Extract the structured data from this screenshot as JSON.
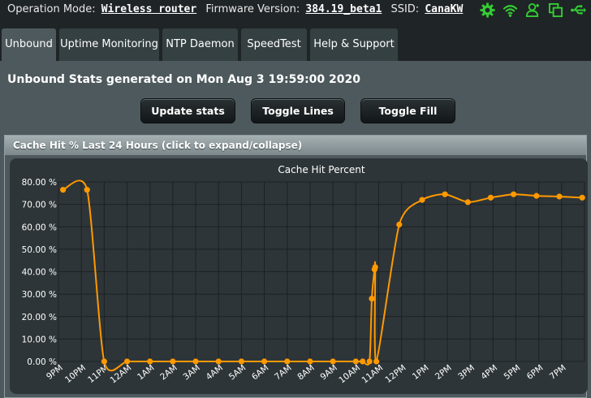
{
  "topbar": {
    "op_mode_label": "Operation Mode:",
    "op_mode_value": "Wireless router",
    "firmware_label": "Firmware Version:",
    "firmware_value": "384.19_beta1",
    "ssid_label": "SSID:",
    "ssid_value": "CanaKW"
  },
  "colors": {
    "icon_green": "#33cc33",
    "line_orange": "#ff9900",
    "chart_bg": "#2e3538",
    "page_bg": "#4d595d"
  },
  "tabs": [
    {
      "label": "Unbound",
      "active": true
    },
    {
      "label": "Uptime Monitoring",
      "active": false
    },
    {
      "label": "NTP Daemon",
      "active": false
    },
    {
      "label": "SpeedTest",
      "active": false
    },
    {
      "label": "Help & Support",
      "active": false
    }
  ],
  "stats_title": "Unbound Stats generated on Mon Aug 3 19:59:00 2020",
  "buttons": {
    "update": "Update stats",
    "toggle_lines": "Toggle Lines",
    "toggle_fill": "Toggle Fill"
  },
  "panel": {
    "header": "Cache Hit % Last 24 Hours (click to expand/collapse)"
  },
  "chart_data": {
    "type": "line",
    "title": "Cache Hit Percent",
    "xlabel": "",
    "ylabel": "",
    "ylim": [
      0,
      80
    ],
    "y_ticks": [
      "80.00 %",
      "70.00 %",
      "60.00 %",
      "50.00 %",
      "40.00 %",
      "30.00 %",
      "20.00 %",
      "10.00 %",
      "0.00 %"
    ],
    "x_ticks": [
      "9PM",
      "10PM",
      "11PM",
      "12AM",
      "1AM",
      "2AM",
      "3AM",
      "4AM",
      "5AM",
      "6AM",
      "7AM",
      "8AM",
      "9AM",
      "10AM",
      "11AM",
      "12PM",
      "1PM",
      "2PM",
      "3PM",
      "4PM",
      "5PM",
      "6PM",
      "7PM"
    ],
    "grid": true,
    "series": [
      {
        "points": [
          {
            "h": 0.2,
            "v": 76.5
          },
          {
            "h": 1.25,
            "v": 76.5
          },
          {
            "h": 2.0,
            "v": 0
          },
          {
            "h": 3.0,
            "v": 0
          },
          {
            "h": 4.0,
            "v": 0
          },
          {
            "h": 5.0,
            "v": 0
          },
          {
            "h": 6.0,
            "v": 0
          },
          {
            "h": 7.0,
            "v": 0
          },
          {
            "h": 8.0,
            "v": 0
          },
          {
            "h": 9.0,
            "v": 0
          },
          {
            "h": 10.0,
            "v": 0
          },
          {
            "h": 11.0,
            "v": 0
          },
          {
            "h": 12.0,
            "v": 0
          },
          {
            "h": 13.0,
            "v": 0
          },
          {
            "h": 13.3,
            "v": 0
          },
          {
            "h": 13.6,
            "v": 0
          },
          {
            "h": 13.7,
            "v": 28
          },
          {
            "h": 13.82,
            "v": 41
          },
          {
            "h": 13.85,
            "v": 42
          },
          {
            "h": 13.9,
            "v": 0
          },
          {
            "h": 14.9,
            "v": 61
          },
          {
            "h": 15.9,
            "v": 72
          },
          {
            "h": 16.9,
            "v": 74.5
          },
          {
            "h": 17.9,
            "v": 71
          },
          {
            "h": 18.9,
            "v": 73
          },
          {
            "h": 19.9,
            "v": 74.5
          },
          {
            "h": 20.9,
            "v": 73.8
          },
          {
            "h": 21.9,
            "v": 73.5
          },
          {
            "h": 22.9,
            "v": 73
          }
        ]
      }
    ]
  }
}
